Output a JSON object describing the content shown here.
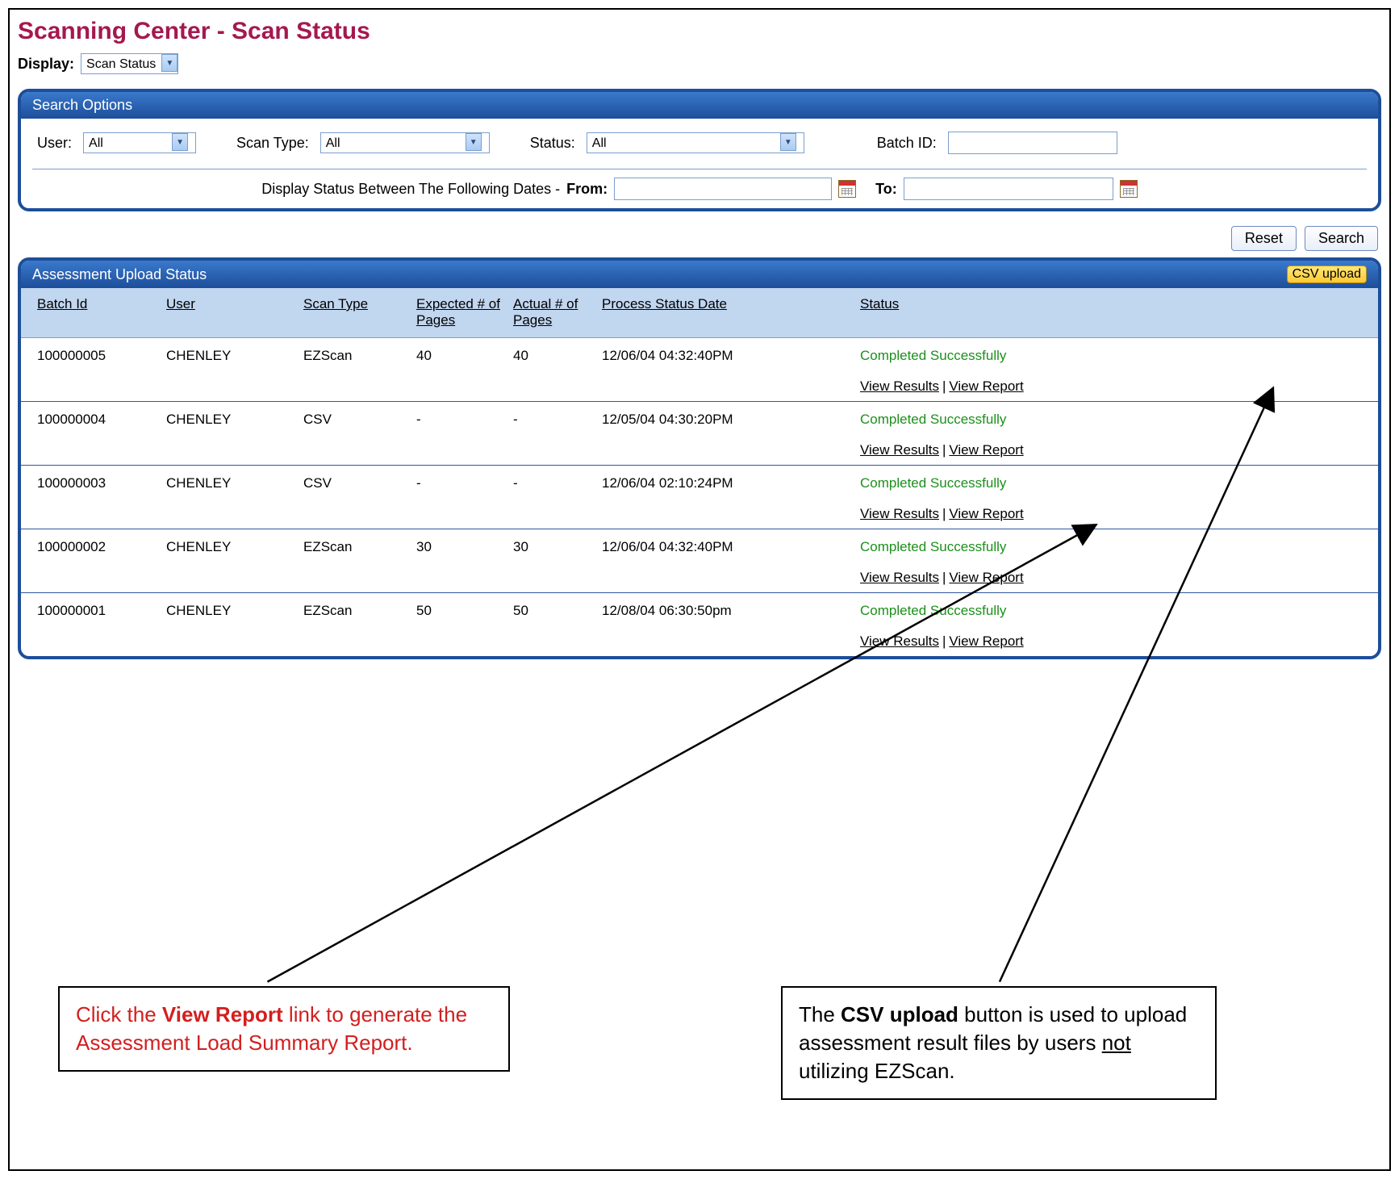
{
  "page_title": "Scanning Center - Scan Status",
  "display_label": "Display:",
  "display_value": "Scan Status",
  "search_options": {
    "title": "Search Options",
    "user_label": "User:",
    "user_value": "All",
    "scan_type_label": "Scan Type:",
    "scan_type_value": "All",
    "status_label": "Status:",
    "status_value": "All",
    "batch_id_label": "Batch ID:",
    "batch_id_value": "",
    "date_row_label": "Display Status Between The Following Dates  -",
    "from_label": "From:",
    "from_value": "",
    "to_label": "To:",
    "to_value": ""
  },
  "buttons": {
    "reset": "Reset",
    "search": "Search",
    "csv_upload": "CSV upload"
  },
  "results": {
    "title": "Assessment Upload Status",
    "columns": {
      "batch_id": "Batch Id",
      "user": "User",
      "scan_type": "Scan Type",
      "expected": "Expected # of Pages",
      "actual": "Actual # of Pages",
      "process_date": "Process Status Date",
      "status": "Status"
    },
    "view_results_label": "View Results",
    "view_report_label": "View Report",
    "rows": [
      {
        "batch_id": "100000005",
        "user": "CHENLEY",
        "scan_type": "EZScan",
        "expected": "40",
        "actual": "40",
        "process_date": "12/06/04 04:32:40PM",
        "status": "Completed Successfully"
      },
      {
        "batch_id": "100000004",
        "user": "CHENLEY",
        "scan_type": "CSV",
        "expected": "-",
        "actual": "-",
        "process_date": "12/05/04 04:30:20PM",
        "status": "Completed Successfully"
      },
      {
        "batch_id": "100000003",
        "user": "CHENLEY",
        "scan_type": "CSV",
        "expected": "-",
        "actual": "-",
        "process_date": "12/06/04 02:10:24PM",
        "status": "Completed Successfully"
      },
      {
        "batch_id": "100000002",
        "user": "CHENLEY",
        "scan_type": "EZScan",
        "expected": "30",
        "actual": "30",
        "process_date": "12/06/04 04:32:40PM",
        "status": "Completed Successfully"
      },
      {
        "batch_id": "100000001",
        "user": "CHENLEY",
        "scan_type": "EZScan",
        "expected": "50",
        "actual": "50",
        "process_date": "12/08/04 06:30:50pm",
        "status": "Completed Successfully"
      }
    ]
  },
  "callouts": {
    "left_pre": "Click the ",
    "left_bold": "View Report",
    "left_post": " link to generate the Assessment Load Summary Report.",
    "right_pre": "The ",
    "right_bold": "CSV upload",
    "right_mid": " button is used to upload assessment result files by users ",
    "right_u": "not",
    "right_post": " utilizing EZScan."
  }
}
